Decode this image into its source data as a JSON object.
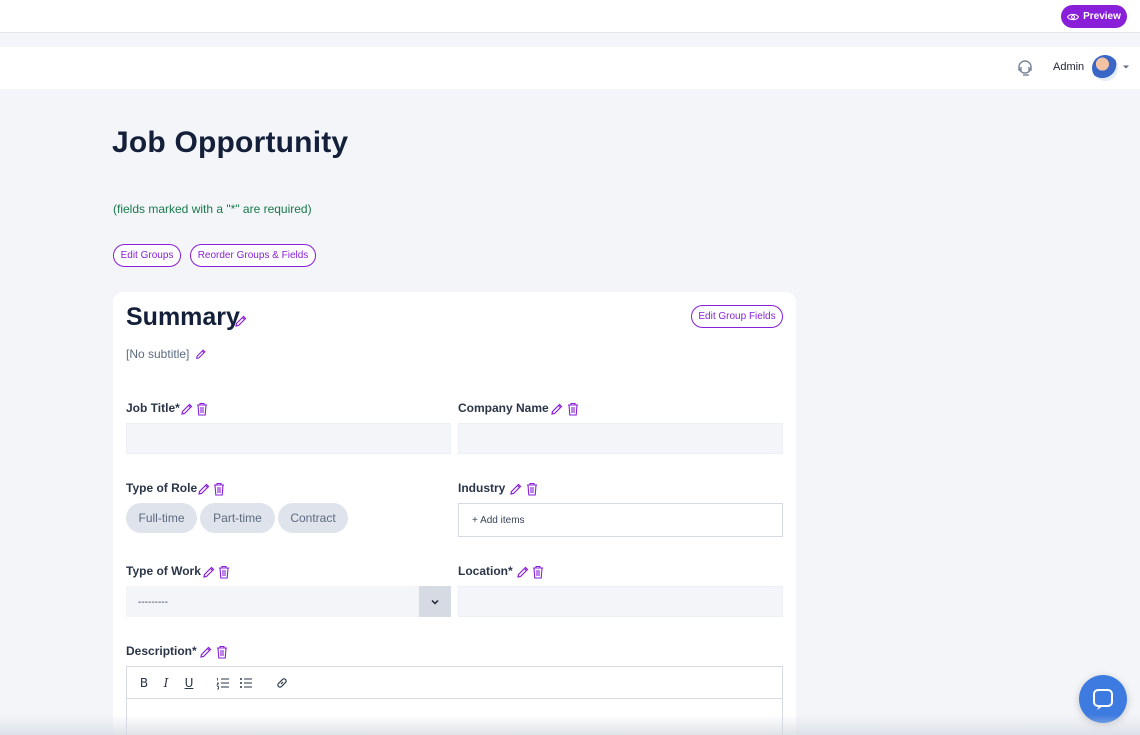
{
  "topbar": {
    "preview_label": "Preview"
  },
  "header": {
    "user_name": "Admin"
  },
  "page": {
    "title": "Job Opportunity",
    "required_note": "(fields marked with a \"*\" are required)",
    "edit_groups_label": "Edit Groups",
    "reorder_label": "Reorder Groups & Fields"
  },
  "group": {
    "title": "Summary",
    "subtitle": "[No subtitle]",
    "edit_fields_label": "Edit Group Fields"
  },
  "fields": {
    "job_title": "Job Title*",
    "company_name": "Company Name",
    "type_of_role": "Type of Role",
    "industry": "Industry",
    "type_of_work": "Type of Work",
    "location": "Location*",
    "description": "Description*"
  },
  "role_options": [
    "Full-time",
    "Part-time",
    "Contract"
  ],
  "industry_placeholder": "+ Add items",
  "type_of_work_value": "---------",
  "editor_toolbar": [
    "B",
    "I",
    "U"
  ],
  "colors": {
    "accent": "#8a1fd9",
    "note": "#197a4b",
    "chat": "#3d7be0"
  }
}
